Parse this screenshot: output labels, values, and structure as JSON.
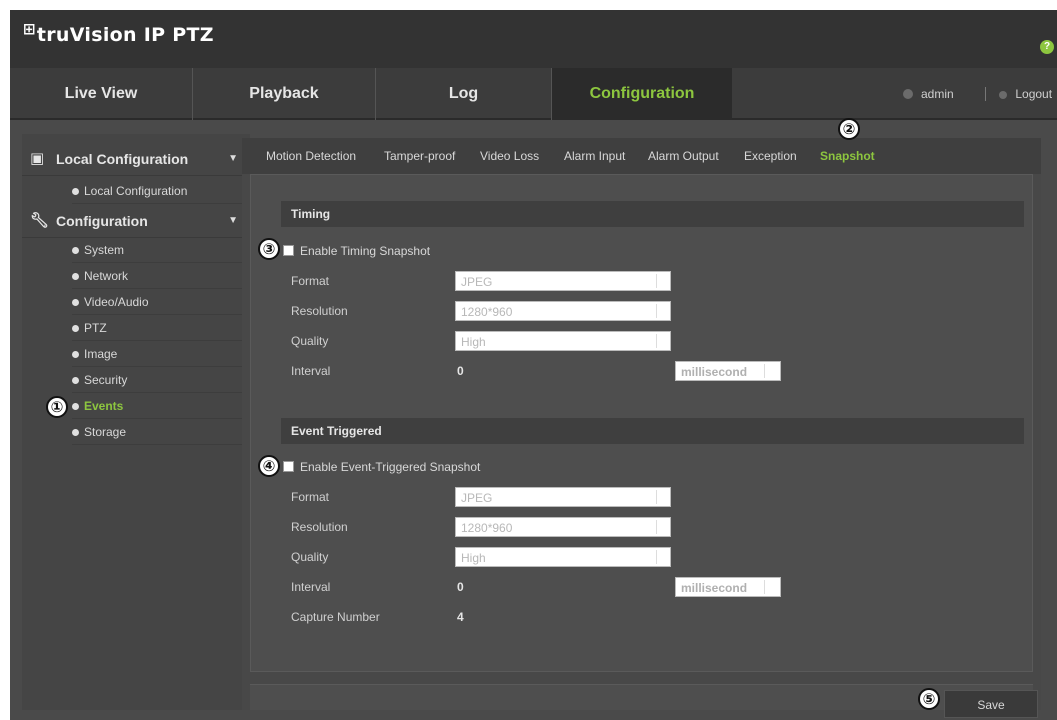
{
  "app": {
    "logo_mark": "⊞",
    "title": "truVision IP PTZ",
    "help_icon": "?"
  },
  "nav": {
    "tabs": [
      {
        "label": "Live View"
      },
      {
        "label": "Playback"
      },
      {
        "label": "Log"
      },
      {
        "label": "Configuration"
      }
    ],
    "user": "admin",
    "logout": "Logout"
  },
  "sidebar": {
    "local_group": {
      "label": "Local Configuration",
      "icon": "monitor-settings-icon"
    },
    "local_items": [
      {
        "label": "Local Configuration"
      }
    ],
    "config_group": {
      "label": "Configuration",
      "icon": "wrench-icon"
    },
    "config_items": [
      {
        "label": "System"
      },
      {
        "label": "Network"
      },
      {
        "label": "Video/Audio"
      },
      {
        "label": "PTZ"
      },
      {
        "label": "Image"
      },
      {
        "label": "Security"
      },
      {
        "label": "Events"
      },
      {
        "label": "Storage"
      }
    ]
  },
  "subtabs": [
    {
      "label": "Motion Detection"
    },
    {
      "label": "Tamper-proof"
    },
    {
      "label": "Video Loss"
    },
    {
      "label": "Alarm Input"
    },
    {
      "label": "Alarm Output"
    },
    {
      "label": "Exception"
    },
    {
      "label": "Snapshot"
    }
  ],
  "timing": {
    "heading": "Timing",
    "enable_label": "Enable Timing Snapshot",
    "format_label": "Format",
    "format_value": "JPEG",
    "resolution_label": "Resolution",
    "resolution_value": "1280*960",
    "quality_label": "Quality",
    "quality_value": "High",
    "interval_label": "Interval",
    "interval_value": "0",
    "interval_unit": "millisecond"
  },
  "event": {
    "heading": "Event Triggered",
    "enable_label": "Enable Event-Triggered Snapshot",
    "format_label": "Format",
    "format_value": "JPEG",
    "resolution_label": "Resolution",
    "resolution_value": "1280*960",
    "quality_label": "Quality",
    "quality_value": "High",
    "interval_label": "Interval",
    "interval_value": "0",
    "interval_unit": "millisecond",
    "capture_label": "Capture Number",
    "capture_value": "4"
  },
  "save_label": "Save",
  "markers": [
    "①",
    "②",
    "③",
    "④",
    "⑤"
  ],
  "colors": {
    "accent": "#8dc63f",
    "background": "#4a4a4a",
    "header": "#333333"
  }
}
